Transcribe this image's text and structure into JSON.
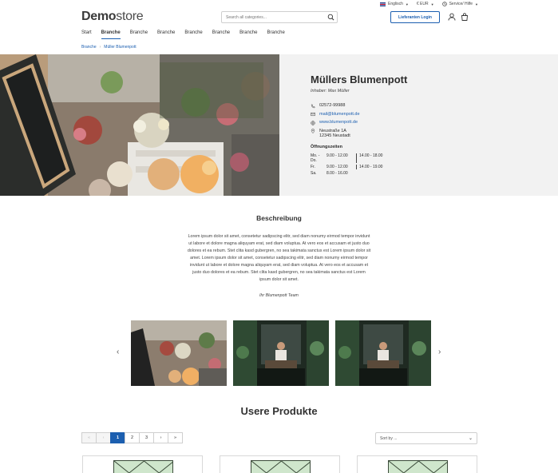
{
  "topbar": {
    "language": "Englisch",
    "currency": "€ EUR",
    "service": "Service/ Hilfe"
  },
  "header": {
    "logo_bold": "Demo",
    "logo_rest": "store",
    "search_placeholder": "Search all categories...",
    "login_label": "Lieferanten Login"
  },
  "nav": {
    "items": [
      {
        "label": "Start"
      },
      {
        "label": "Branche"
      },
      {
        "label": "Branche"
      },
      {
        "label": "Branche"
      },
      {
        "label": "Branche"
      },
      {
        "label": "Branche"
      },
      {
        "label": "Branche"
      },
      {
        "label": "Branche"
      }
    ],
    "active_index": 1
  },
  "breadcrumb": {
    "items": [
      "Branche",
      "Müller Blumenpott"
    ]
  },
  "shop": {
    "name": "Müllers Blumenpott",
    "owner": "Inhaber: Max Müller",
    "phone": "02572-99988",
    "email": "mail@blumenpott.de",
    "website": "www.blumenpott.de",
    "street": "Neustraße 1A",
    "city": "12345 Neustadt",
    "hours_title": "Öffnungszeiten",
    "hours": [
      {
        "day": "Mo. - Do.",
        "morning": "9.00 - 12.00",
        "afternoon": "14.00 - 18.00"
      },
      {
        "day": "Fr.",
        "morning": "9.00 - 12.00",
        "afternoon": "14.00 - 19.00"
      },
      {
        "day": "Sa.",
        "morning": "8.00 - 16.00",
        "afternoon": ""
      }
    ]
  },
  "description": {
    "title": "Beschreibung",
    "text": "Lorem ipsum dolor sit amet, consetetur sadipscing elitr, sed diam nonumy eirmod tempor invidunt ut labore et dolore magna aliquyam erat, sed diam voluptua. At vero eos et accusam et justo duo dolores et ea rebum. Stet clita kasd gubergren, no sea takimata sanctus est Lorem ipsum dolor sit amet. Lorem ipsum dolor sit amet, consetetur sadipscing elitr, sed diam nonumy eirmod tempor invidunt ut labore et dolore magna aliquyam erat, sed diam voluptua. At vero eos et accusam et justo duo dolores et ea rebum. Stet clita kasd gubergren, no sea takimata sanctus est Lorem ipsum dolor sit amet.",
    "signature": "Ihr Blumenpott Team"
  },
  "products": {
    "title": "Usere Produkte",
    "pager": {
      "first": "«",
      "prev": "‹",
      "pages": [
        "1",
        "2",
        "3"
      ],
      "next": "›",
      "last": "»",
      "current": "1"
    },
    "sort_placeholder": "Sort by ..."
  },
  "colors": {
    "accent": "#1c5fb0",
    "hero_bg": "#f2f2f2",
    "placeholder_green": "#cfe6cc"
  },
  "icons": [
    "search-icon",
    "user-icon",
    "cart-icon",
    "phone-icon",
    "mail-icon",
    "globe-icon",
    "location-icon",
    "chevron-left-icon",
    "chevron-right-icon",
    "chevron-down-icon"
  ]
}
